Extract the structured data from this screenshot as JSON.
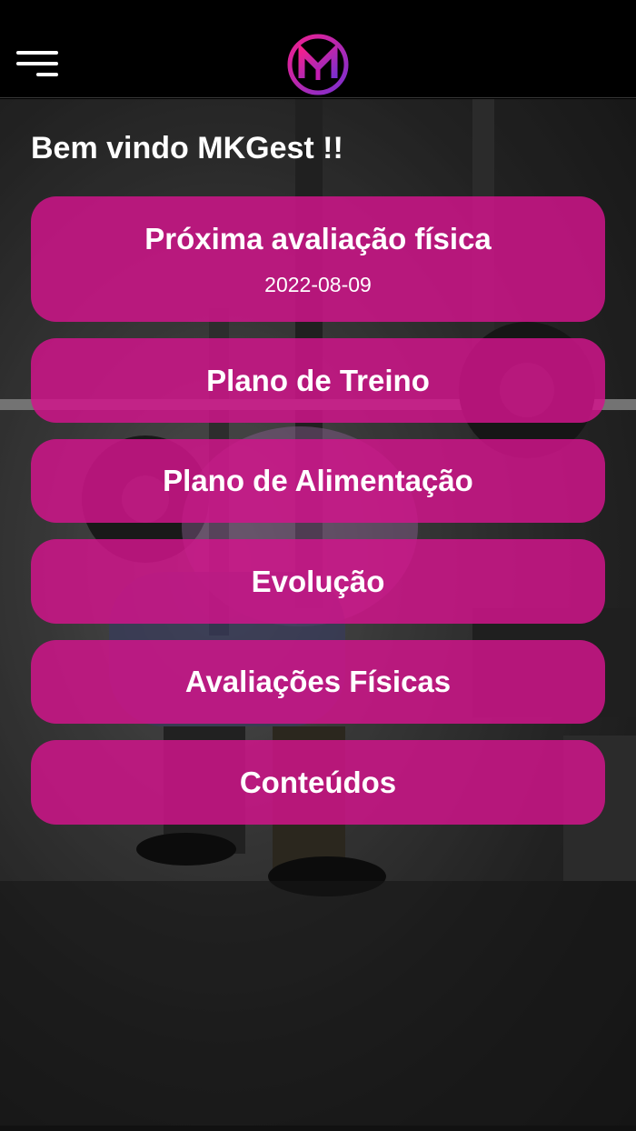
{
  "header": {
    "menu_icon": "hamburger-menu-icon",
    "logo_icon": "mk-logo-icon",
    "logo_colors": [
      "#e0208f",
      "#7a2fd0"
    ]
  },
  "welcome": "Bem vindo MKGest !!",
  "cards": [
    {
      "title": "Próxima avaliação física",
      "subtitle": "2022-08-09"
    },
    {
      "title": "Plano de Treino"
    },
    {
      "title": "Plano de Alimentação"
    },
    {
      "title": "Evolução"
    },
    {
      "title": "Avaliações Físicas"
    },
    {
      "title": "Conteúdos"
    }
  ],
  "colors": {
    "card_background": "#d2148c",
    "topbar": "#000000"
  }
}
